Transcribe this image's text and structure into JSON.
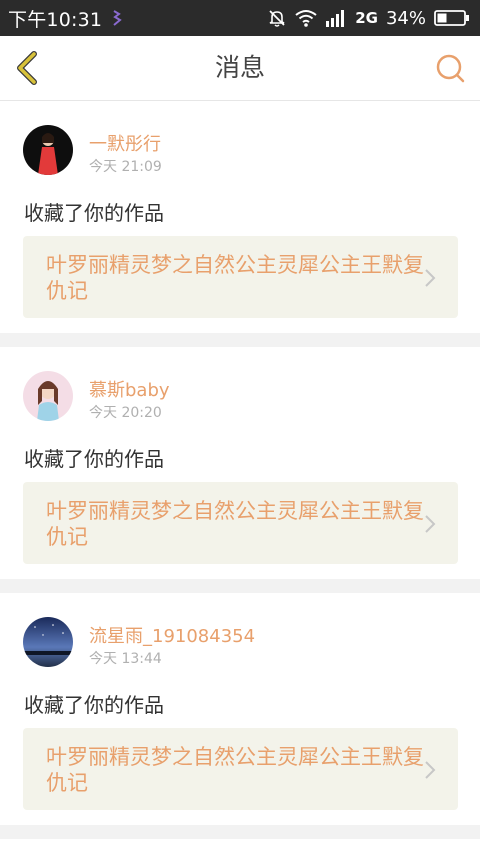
{
  "status_bar": {
    "time": "下午10:31",
    "network": "2G",
    "battery": "34%"
  },
  "header": {
    "title": "消息"
  },
  "messages": [
    {
      "username": "一默彤行",
      "time": "今天 21:09",
      "action": "收藏了你的作品",
      "work_title": "叶罗丽精灵梦之自然公主灵犀公主王默复仇记"
    },
    {
      "username": "慕斯baby",
      "time": "今天 20:20",
      "action": "收藏了你的作品",
      "work_title": "叶罗丽精灵梦之自然公主灵犀公主王默复仇记"
    },
    {
      "username": "流星雨_191084354",
      "time": "今天 13:44",
      "action": "收藏了你的作品",
      "work_title": "叶罗丽精灵梦之自然公主灵犀公主王默复仇记"
    }
  ],
  "colors": {
    "accent": "#e8a06c",
    "work_box_bg": "#f3f3ea",
    "back_icon": "#d8c23a"
  }
}
